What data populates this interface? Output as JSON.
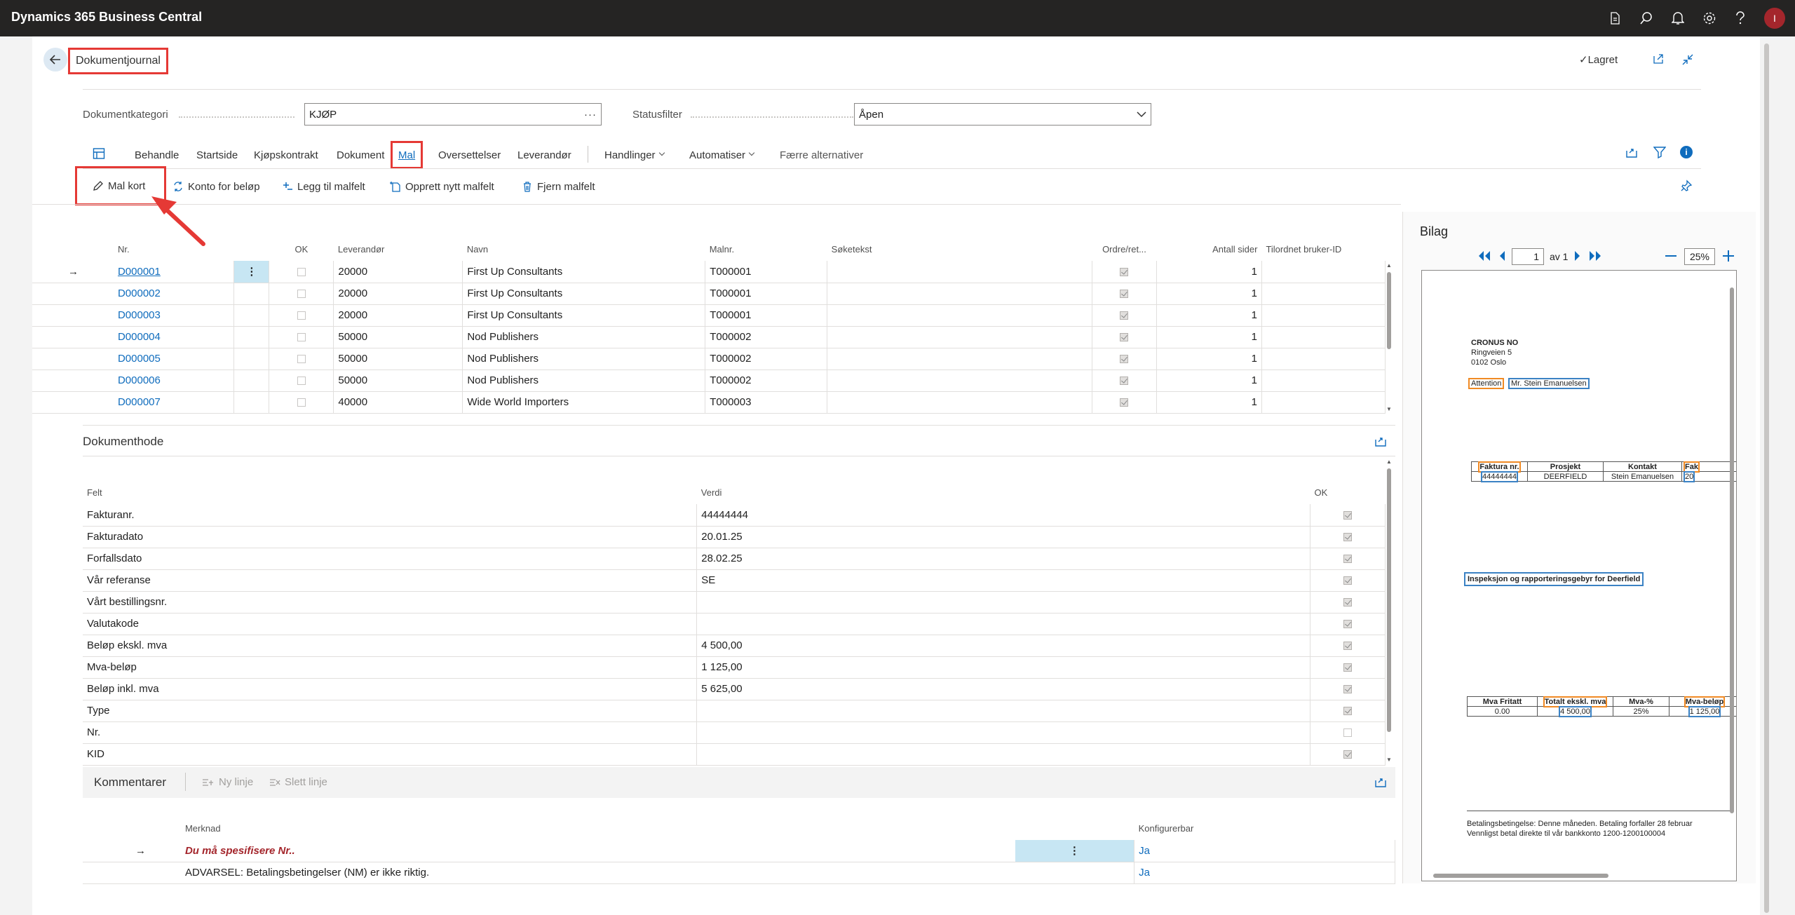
{
  "app": {
    "title": "Dynamics 365 Business Central",
    "user_initial": "I"
  },
  "topbar_icons": [
    "document-icon",
    "search-icon",
    "bell-icon",
    "gear-icon",
    "help-icon"
  ],
  "page": {
    "title": "Dokumentjournal",
    "saved_label": "Lagret"
  },
  "filters": {
    "category_label": "Dokumentkategori",
    "category_value": "KJØP",
    "status_label": "Statusfilter",
    "status_value": "Åpen"
  },
  "nav": {
    "items": [
      "Behandle",
      "Startside",
      "Kjøpskontrakt",
      "Dokument",
      "Mal",
      "Oversettelser",
      "Leverandør"
    ],
    "menus": [
      "Handlinger",
      "Automatiser"
    ],
    "fewer": "Færre alternativer",
    "active": "Mal"
  },
  "actions": [
    "Mal kort",
    "Konto for beløp",
    "Legg til malfelt",
    "Opprett nytt malfelt",
    "Fjern malfelt"
  ],
  "documents": {
    "headers": [
      "Nr.",
      "OK",
      "Leverandør",
      "Navn",
      "Malnr.",
      "Søketekst",
      "Ordre/ret...",
      "Antall sider",
      "Tilordnet bruker-ID"
    ],
    "rows": [
      {
        "nr": "D000001",
        "vendor": "20000",
        "name": "First Up Consultants",
        "template": "T000001",
        "search": "",
        "pages": "1"
      },
      {
        "nr": "D000002",
        "vendor": "20000",
        "name": "First Up Consultants",
        "template": "T000001",
        "search": "",
        "pages": "1"
      },
      {
        "nr": "D000003",
        "vendor": "20000",
        "name": "First Up Consultants",
        "template": "T000001",
        "search": "",
        "pages": "1"
      },
      {
        "nr": "D000004",
        "vendor": "50000",
        "name": "Nod Publishers",
        "template": "T000002",
        "search": "",
        "pages": "1"
      },
      {
        "nr": "D000005",
        "vendor": "50000",
        "name": "Nod Publishers",
        "template": "T000002",
        "search": "",
        "pages": "1"
      },
      {
        "nr": "D000006",
        "vendor": "50000",
        "name": "Nod Publishers",
        "template": "T000002",
        "search": "",
        "pages": "1"
      },
      {
        "nr": "D000007",
        "vendor": "40000",
        "name": "Wide World Importers",
        "template": "T000003",
        "search": "",
        "pages": "1"
      }
    ]
  },
  "header_section": {
    "title": "Dokumenthode",
    "headers": [
      "Felt",
      "Verdi",
      "OK"
    ],
    "rows": [
      {
        "field": "Fakturanr.",
        "value": "44444444",
        "ok": true
      },
      {
        "field": "Fakturadato",
        "value": "20.01.25",
        "ok": true
      },
      {
        "field": "Forfallsdato",
        "value": "28.02.25",
        "ok": true
      },
      {
        "field": "Vår referanse",
        "value": "SE",
        "ok": true
      },
      {
        "field": "Vårt bestillingsnr.",
        "value": "",
        "ok": true
      },
      {
        "field": "Valutakode",
        "value": "",
        "ok": true
      },
      {
        "field": "Beløp ekskl. mva",
        "value": "4 500,00",
        "ok": true
      },
      {
        "field": "Mva-beløp",
        "value": "1 125,00",
        "ok": true
      },
      {
        "field": "Beløp inkl. mva",
        "value": "5 625,00",
        "ok": true
      },
      {
        "field": "Type",
        "value": "",
        "ok": true
      },
      {
        "field": "Nr.",
        "value": "",
        "ok": false
      },
      {
        "field": "KID",
        "value": "",
        "ok": true
      }
    ]
  },
  "comments": {
    "title": "Kommentarer",
    "new_line": "Ny linje",
    "delete_line": "Slett linje",
    "headers": [
      "Merknad",
      "Konfigurerbar"
    ],
    "rows": [
      {
        "note": "Du må spesifisere Nr..",
        "configurable": "Ja",
        "error": true
      },
      {
        "note": "ADVARSEL: Betalingsbetingelser (NM) er ikke riktig.",
        "configurable": "Ja",
        "error": false
      }
    ]
  },
  "attachment": {
    "title": "Bilag",
    "page_current": "1",
    "page_of": "av 1",
    "zoom": "25%",
    "doc": {
      "company": "CRONUS NO",
      "address1": "Ringveien 5",
      "address2": "0102 Oslo",
      "attention_label": "Attention",
      "attention_name": "Mr. Stein Emanuelsen",
      "t1_headers": [
        "Faktura nr.",
        "Prosjekt",
        "Kontakt",
        "Fak"
      ],
      "t1_values": [
        "44444444",
        "DEERFIELD",
        "Stein Emanuelsen",
        "20"
      ],
      "description": "Inspeksjon og rapporteringsgebyr for Deerfield",
      "t2_headers": [
        "Mva Fritatt",
        "Totalt ekskl. mva",
        "Mva-%",
        "Mva-beløp"
      ],
      "t2_values": [
        "0.00",
        "4 500,00",
        "25%",
        "1 125,00"
      ],
      "terms1": "Betalingsbetingelse: Denne måneden. Betaling forfaller 28 februar",
      "terms2": "Vennligst betal direkte til vår bankkonto 1200-1200100004"
    }
  },
  "colors": {
    "accent": "#0f6cbd",
    "highlight": "#e53935",
    "topbar": "#252423",
    "selected_cell": "#c7e6f3",
    "error_text": "#a4262c"
  }
}
